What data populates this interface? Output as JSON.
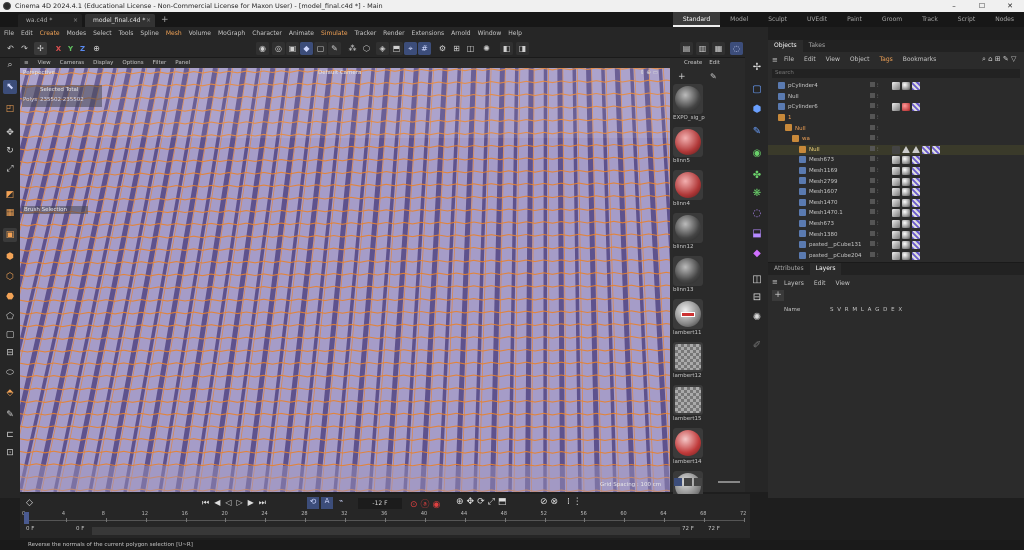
{
  "window": {
    "title": "Cinema 4D 2024.4.1 (Educational License - Non-Commercial License for Maxon User) - [model_final.c4d *] - Main",
    "minimize": "–",
    "maximize": "☐",
    "close": "✕"
  },
  "doc_tabs": [
    {
      "label": "wa.c4d *",
      "active": false
    },
    {
      "label": "model_final.c4d *",
      "active": true
    }
  ],
  "add_tab": "+",
  "layouts": [
    "Standard",
    "Model",
    "Sculpt",
    "UVEdit",
    "Paint",
    "Groom",
    "Track",
    "Script",
    "Nodes"
  ],
  "active_layout": "Standard",
  "menu": [
    "File",
    "Edit",
    "Create",
    "Modes",
    "Select",
    "Tools",
    "Spline",
    "Mesh",
    "Volume",
    "MoGraph",
    "Character",
    "Animate",
    "Simulate",
    "Tracker",
    "Render",
    "Extensions",
    "Arnold",
    "Window",
    "Help"
  ],
  "menu_highlight": [
    "Create",
    "Mesh",
    "Simulate"
  ],
  "toolbar_axes": [
    "X",
    "Y",
    "Z"
  ],
  "viewport": {
    "menu": [
      "View",
      "Cameras",
      "Display",
      "Options",
      "Filter",
      "Panel"
    ],
    "view_name": "Perspective",
    "camera": "Default Camera",
    "hud_selected": "Selected Total",
    "hud_polys_label": "Polys",
    "hud_polys_values": "235502   235502",
    "hud_brush": "Brush Selection",
    "grid_spacing": "Grid Spacing : 100 cm",
    "colors": {
      "surface": "#a59cc8",
      "groove": "#5b4f8a",
      "edge": "#e8822e"
    }
  },
  "materials": {
    "menu": [
      "Create",
      "Edit"
    ],
    "items": [
      {
        "name": "EXPO_sig_p",
        "type": "dark"
      },
      {
        "name": "blinn5",
        "type": "red"
      },
      {
        "name": "blinn4",
        "type": "red"
      },
      {
        "name": "blinn12",
        "type": "dark"
      },
      {
        "name": "blinn13",
        "type": "dark"
      },
      {
        "name": "lambert11",
        "type": "logo"
      },
      {
        "name": "lambert12",
        "type": "checker"
      },
      {
        "name": "lambert15",
        "type": "checker"
      },
      {
        "name": "lambert14",
        "type": "redpattern"
      },
      {
        "name": "",
        "type": "grey"
      }
    ]
  },
  "objects_panel": {
    "tabs": [
      "Objects",
      "Takes"
    ],
    "menu": [
      "File",
      "Edit",
      "View",
      "Object",
      "Tags",
      "Bookmarks"
    ],
    "search_placeholder": "Search",
    "rows": [
      {
        "name": "pCylinder4",
        "indent": 0,
        "color": "#c8c8c8",
        "tags": [
          "white",
          "gloss",
          "check"
        ]
      },
      {
        "name": "Null",
        "indent": 0,
        "color": "#c8c8c8",
        "tags": []
      },
      {
        "name": "pCylinder6",
        "indent": 0,
        "color": "#c8c8c8",
        "tags": [
          "white",
          "red",
          "check"
        ]
      },
      {
        "name": "1",
        "indent": 0,
        "color": "#f3a356",
        "tags": []
      },
      {
        "name": "Null",
        "indent": 1,
        "color": "#f3a356",
        "tags": []
      },
      {
        "name": "wa",
        "indent": 2,
        "color": "#f3a356",
        "tags": []
      },
      {
        "name": "Null",
        "indent": 3,
        "color": "#f5d77a",
        "tags": [
          "dark",
          "tri",
          "tri",
          "check",
          "check"
        ]
      },
      {
        "name": "Mesh673",
        "indent": 3,
        "color": "#c8c8c8",
        "tags": [
          "white",
          "gloss",
          "check"
        ]
      },
      {
        "name": "Mesh1169",
        "indent": 3,
        "color": "#c8c8c8",
        "tags": [
          "white",
          "gloss",
          "check"
        ]
      },
      {
        "name": "Mesh2799",
        "indent": 3,
        "color": "#c8c8c8",
        "tags": [
          "white",
          "gloss",
          "check"
        ]
      },
      {
        "name": "Mesh1607",
        "indent": 3,
        "color": "#c8c8c8",
        "tags": [
          "white",
          "gloss",
          "check"
        ]
      },
      {
        "name": "Mesh1470",
        "indent": 3,
        "color": "#c8c8c8",
        "tags": [
          "white",
          "gloss",
          "check"
        ]
      },
      {
        "name": "Mesh1470.1",
        "indent": 3,
        "color": "#c8c8c8",
        "tags": [
          "white",
          "gloss",
          "check"
        ]
      },
      {
        "name": "Mesh673",
        "indent": 3,
        "color": "#c8c8c8",
        "tags": [
          "white",
          "gloss",
          "check"
        ]
      },
      {
        "name": "Mesh1380",
        "indent": 3,
        "color": "#c8c8c8",
        "tags": [
          "white",
          "gloss",
          "check"
        ]
      },
      {
        "name": "pasted__pCube131",
        "indent": 3,
        "color": "#c8c8c8",
        "tags": [
          "white",
          "gloss",
          "check"
        ]
      },
      {
        "name": "pasted__pCube204",
        "indent": 3,
        "color": "#c8c8c8",
        "tags": [
          "white",
          "gloss",
          "check"
        ]
      }
    ]
  },
  "attributes_panel": {
    "tabs": [
      "Attributes",
      "Layers"
    ],
    "active_tab": "Layers",
    "menu": [
      "Layers",
      "Edit",
      "View"
    ],
    "add": "+",
    "col_name": "Name",
    "col_flags": "S V R M L A G D E X"
  },
  "timeline": {
    "current_frame": "-12 F",
    "ticks": [
      "0",
      "4",
      "8",
      "12",
      "16",
      "20",
      "24",
      "28",
      "32",
      "36",
      "40",
      "44",
      "48",
      "52",
      "56",
      "60",
      "64",
      "68",
      "72"
    ],
    "start_a": "0 F",
    "start_b": "0 F",
    "end_a": "72 F",
    "end_b": "72 F"
  },
  "status": "Reverse the normals of the current polygon selection [U~R]"
}
